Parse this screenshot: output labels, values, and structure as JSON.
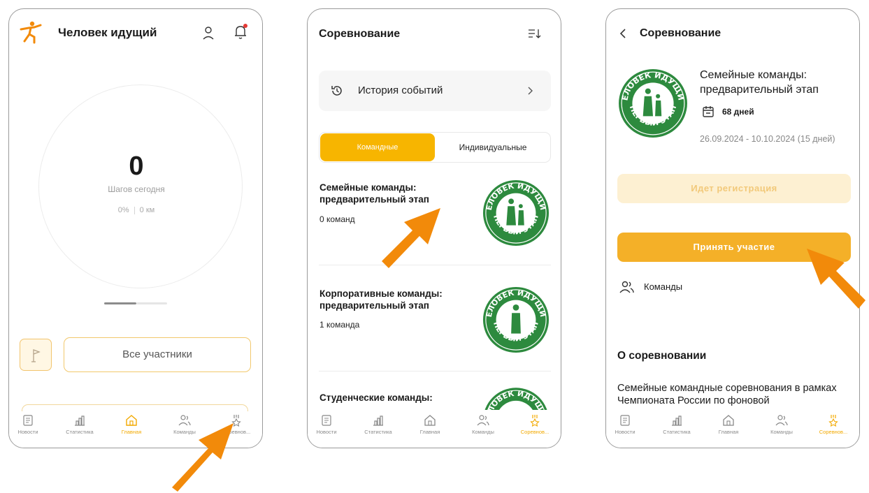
{
  "colors": {
    "accent": "#f7b500",
    "arrow": "#f28a0a",
    "logo_green": "#2d8a3e"
  },
  "tabs": [
    "Новости",
    "Статистика",
    "Главная",
    "Команды",
    "Соревнов..."
  ],
  "screen1": {
    "app_title": "Человек идущий",
    "steps_value": "0",
    "steps_label": "Шагов сегодня",
    "percent": "0%",
    "distance": "0 км",
    "all_participants": "Все участники",
    "active_tab": "Главная"
  },
  "screen2": {
    "title": "Соревнование",
    "history_label": "История событий",
    "segment_team": "Командные",
    "segment_individual": "Индивидуальные",
    "competitions": [
      {
        "title": "Семейные команды: предварительный этап",
        "count": "0 команд"
      },
      {
        "title": "Корпоративные команды: предварительный этап",
        "count": "1 команда"
      },
      {
        "title": "Студенческие команды:",
        "count": ""
      }
    ],
    "logo_text_top": "ЧЕЛОВЕК ИДУЩИЙ",
    "logo_text_bottom": "ПЕРВЫЙ ЭТАП",
    "active_tab": "Соревнов..."
  },
  "screen3": {
    "title": "Соревнование",
    "comp_title": "Семейные команды: предварительный этап",
    "days": "68 дней",
    "dates": "26.09.2024 - 10.10.2024 (15 дней)",
    "registration": "Идет регистрация",
    "join": "Принять участие",
    "teams": "Команды",
    "about_heading": "О соревновании",
    "about_text": "Семейные командные соревнования в рамках Чемпионата России по фоновой",
    "active_tab": "Соревнов..."
  }
}
